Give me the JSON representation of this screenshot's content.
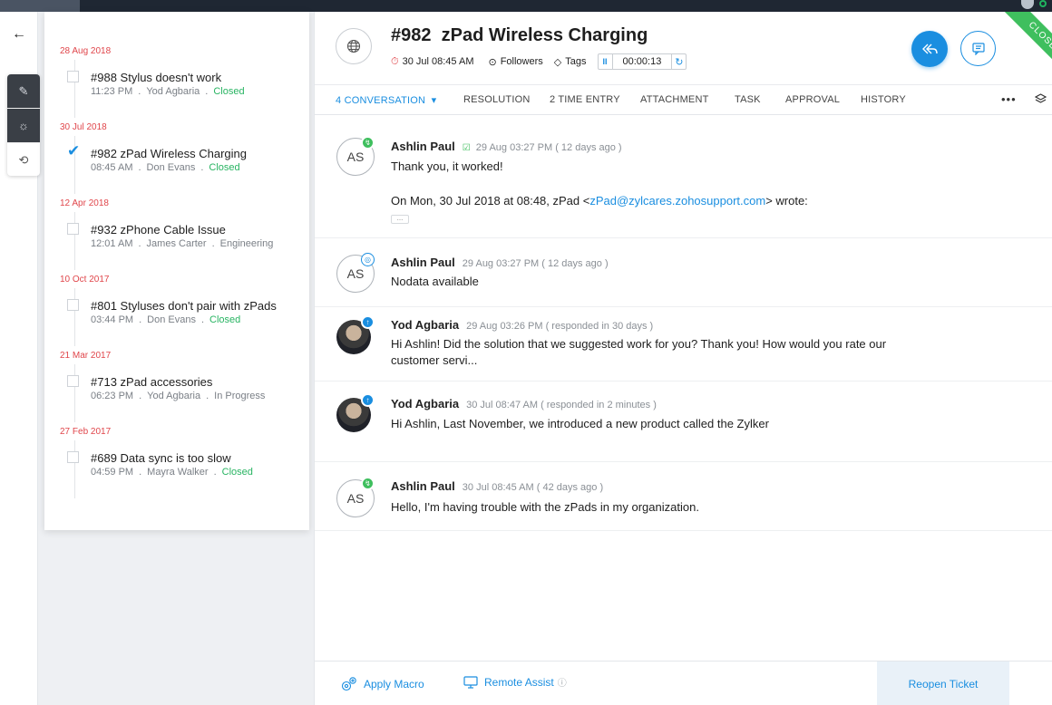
{
  "topbar": {},
  "rail": {
    "back": "←",
    "tools": [
      "✎",
      "☼",
      "⟲"
    ]
  },
  "ticket_list": {
    "groups": [
      {
        "date": "28 Aug 2018",
        "title": "#988 Stylus doesn't work",
        "time": "11:23 PM",
        "agent": "Yod Agbaria",
        "status": "Closed",
        "status_kind": "closed",
        "checked": false
      },
      {
        "date": "30 Jul 2018",
        "title": "#982 zPad Wireless Charging",
        "time": "08:45 AM",
        "agent": "Don Evans",
        "status": "Closed",
        "status_kind": "closed",
        "checked": true
      },
      {
        "date": "12 Apr 2018",
        "title": "#932 zPhone Cable Issue",
        "time": "12:01 AM",
        "agent": "James Carter",
        "status": "Engineering",
        "status_kind": "other",
        "checked": false
      },
      {
        "date": "10 Oct 2017",
        "title": "#801 Styluses don't pair with zPads",
        "time": "03:44 PM",
        "agent": "Don Evans",
        "status": "Closed",
        "status_kind": "closed",
        "checked": false
      },
      {
        "date": "21 Mar 2017",
        "title": "#713 zPad accessories",
        "time": "06:23 PM",
        "agent": "Yod Agbaria",
        "status": "In Progress",
        "status_kind": "other",
        "checked": false
      },
      {
        "date": "27 Feb 2017",
        "title": "#689 Data sync is too slow",
        "time": "04:59 PM",
        "agent": "Mayra Walker",
        "status": "Closed",
        "status_kind": "closed",
        "checked": false
      }
    ],
    "separator": "."
  },
  "header": {
    "number": "#982",
    "title": "zPad Wireless Charging",
    "due": "30 Jul 08:45 AM",
    "followers": "Followers",
    "tags": "Tags",
    "timer": "00:00:13",
    "ribbon": "CLOSED"
  },
  "tabs": {
    "conversation": "4 CONVERSATION",
    "resolution": "RESOLUTION",
    "time_entry": "2 TIME ENTRY",
    "attachment": "ATTACHMENT",
    "task": "TASK",
    "approval": "APPROVAL",
    "history": "HISTORY",
    "more": "•••"
  },
  "thread": [
    {
      "initials": "AS",
      "name": "Ashlin Paul",
      "time": "29 Aug 03:27 PM ( 12 days ago )",
      "text": "Thank you, it worked!",
      "quote_prefix": "On Mon, 30 Jul 2018 at 08:48, zPad <",
      "quote_email": "zPad@zylcares.zohosupport.com",
      "quote_suffix": "> wrote:",
      "ellipsis": "..."
    },
    {
      "initials": "AS",
      "name": "Ashlin Paul",
      "time": "29 Aug 03:27 PM ( 12 days ago )",
      "text": "Nodata available"
    },
    {
      "name": "Yod Agbaria",
      "time": "29 Aug 03:26 PM ( responded in 30 days )",
      "text_line1": "Hi Ashlin! Did the solution that we suggested work for you? Thank you! How would you rate our",
      "text_line2": "customer servi..."
    },
    {
      "name": "Yod Agbaria",
      "time": "30 Jul 08:47 AM ( responded in 2 minutes )",
      "text": "Hi Ashlin, Last November, we introduced a new product called the Zylker"
    },
    {
      "initials": "AS",
      "name": "Ashlin Paul",
      "time": "30 Jul 08:45 AM ( 42 days ago )",
      "text": "Hello, I'm having trouble with the zPads in my organization."
    }
  ],
  "footer": {
    "apply_macro": "Apply Macro",
    "remote_assist": "Remote Assist",
    "reopen": "Reopen Ticket"
  },
  "colors": {
    "accent": "#1a8ee0",
    "closed": "#28b462",
    "date": "#e0464b",
    "ribbon": "#3fbf5e"
  }
}
